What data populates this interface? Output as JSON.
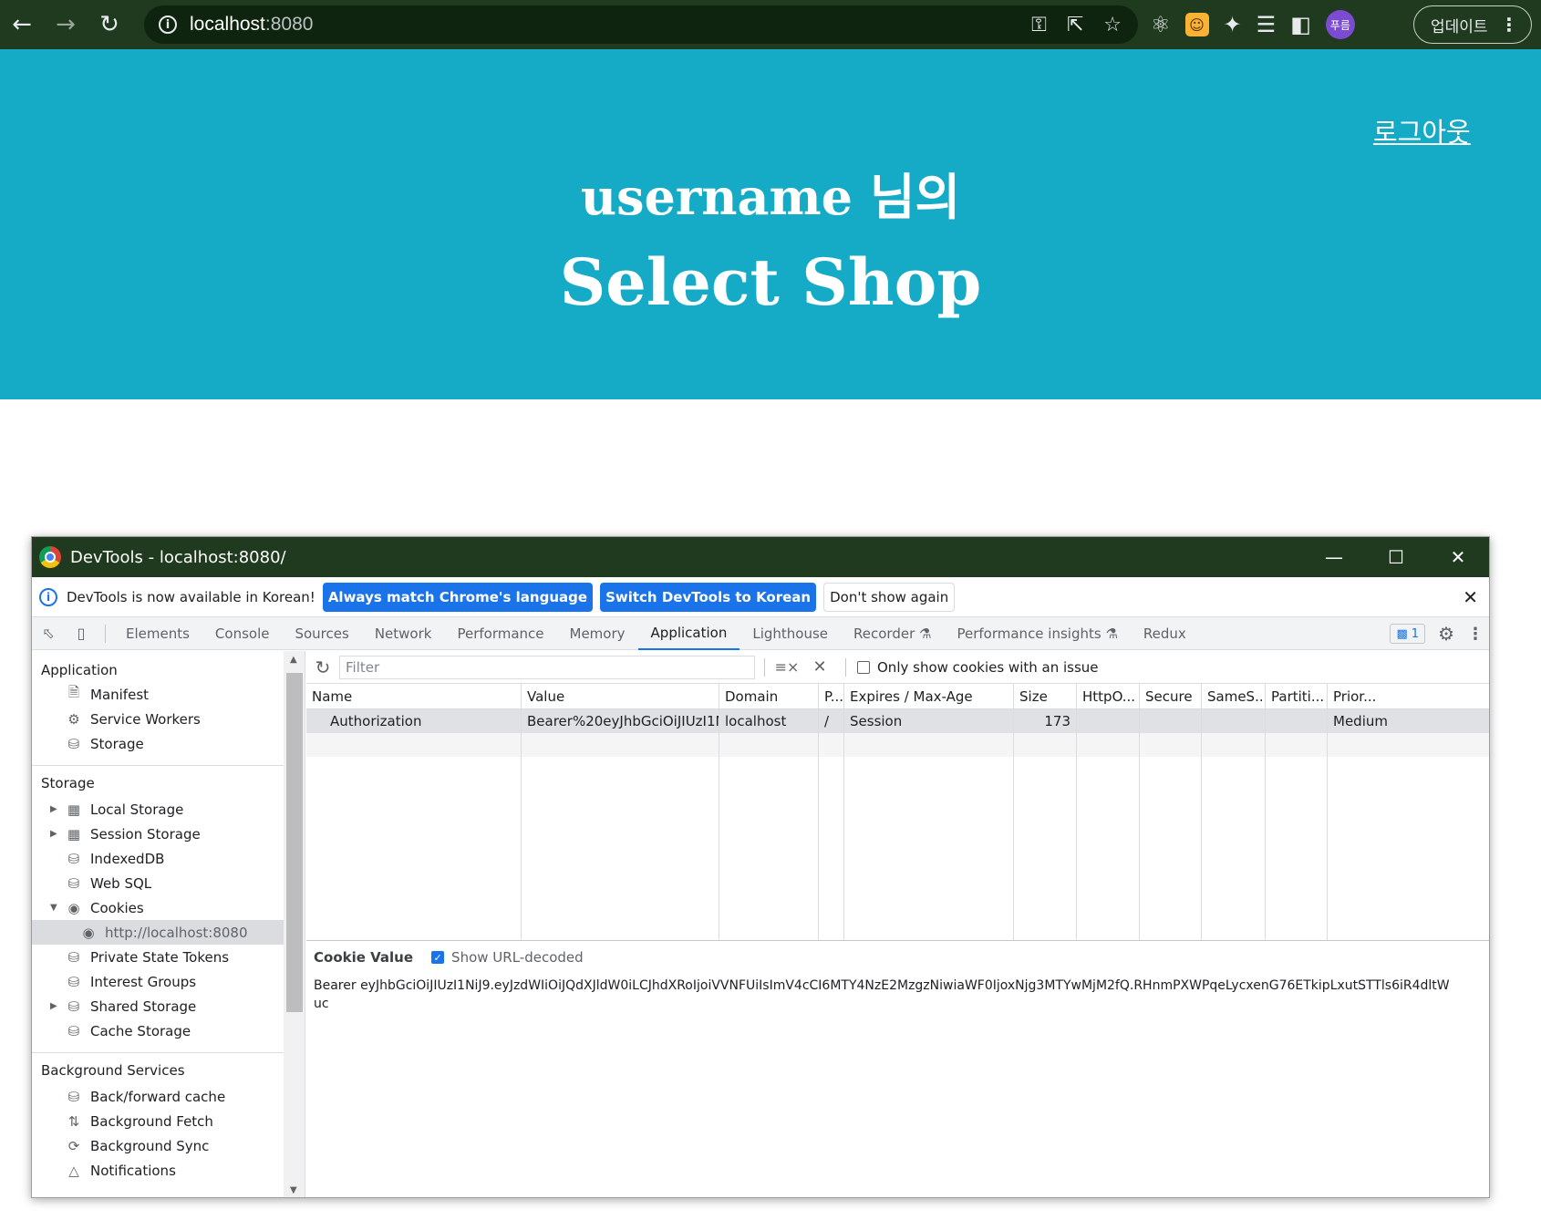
{
  "browser": {
    "url_host": "localhost",
    "url_port": ":8080",
    "profile_initials": "푸름",
    "update_label": "업데이트"
  },
  "page": {
    "logout_label": "로그아웃",
    "greeting": "username 님의",
    "title": "Select Shop",
    "hero_color": "#15abc6"
  },
  "devtools": {
    "window_title": "DevTools - localhost:8080/",
    "infobar": {
      "message": "DevTools is now available in Korean!",
      "btn_match": "Always match Chrome's language",
      "btn_switch": "Switch DevTools to Korean",
      "btn_dismiss": "Don't show again"
    },
    "tabs": [
      "Elements",
      "Console",
      "Sources",
      "Network",
      "Performance",
      "Memory",
      "Application",
      "Lighthouse",
      "Recorder",
      "Performance insights",
      "Redux"
    ],
    "active_tab": "Application",
    "issues_count": "1",
    "sidebar": {
      "application_title": "Application",
      "application_items": [
        "Manifest",
        "Service Workers",
        "Storage"
      ],
      "storage_title": "Storage",
      "storage_items": [
        "Local Storage",
        "Session Storage",
        "IndexedDB",
        "Web SQL",
        "Cookies",
        "http://localhost:8080",
        "Private State Tokens",
        "Interest Groups",
        "Shared Storage",
        "Cache Storage"
      ],
      "background_title": "Background Services",
      "background_items": [
        "Back/forward cache",
        "Background Fetch",
        "Background Sync",
        "Notifications"
      ]
    },
    "filter": {
      "placeholder": "Filter",
      "only_issue_label": "Only show cookies with an issue"
    },
    "columns": [
      "Name",
      "Value",
      "Domain",
      "P...",
      "Expires / Max-Age",
      "Size",
      "HttpO...",
      "Secure",
      "SameS...",
      "Partiti...",
      "Prior..."
    ],
    "rows": [
      {
        "name": "Authorization",
        "value": "Bearer%20eyJhbGciOiJIUzI1N...",
        "domain": "localhost",
        "path": "/",
        "expires": "Session",
        "size": "173",
        "httponly": "",
        "secure": "",
        "samesite": "",
        "partition": "",
        "priority": "Medium"
      }
    ],
    "cookie_value": {
      "title": "Cookie Value",
      "show_decoded_label": "Show URL-decoded",
      "value": "Bearer eyJhbGciOiJIUzI1NiJ9.eyJzdWIiOiJQdXJldW0iLCJhdXRoIjoiVVNFUiIsImV4cCI6MTY4NzE2MzgzNiwiaWF0IjoxNjg3MTYwMjM2fQ.RHnmPXWPqeLycxenG76ETkipLxutSTTls6iR4dltWuc"
    }
  }
}
